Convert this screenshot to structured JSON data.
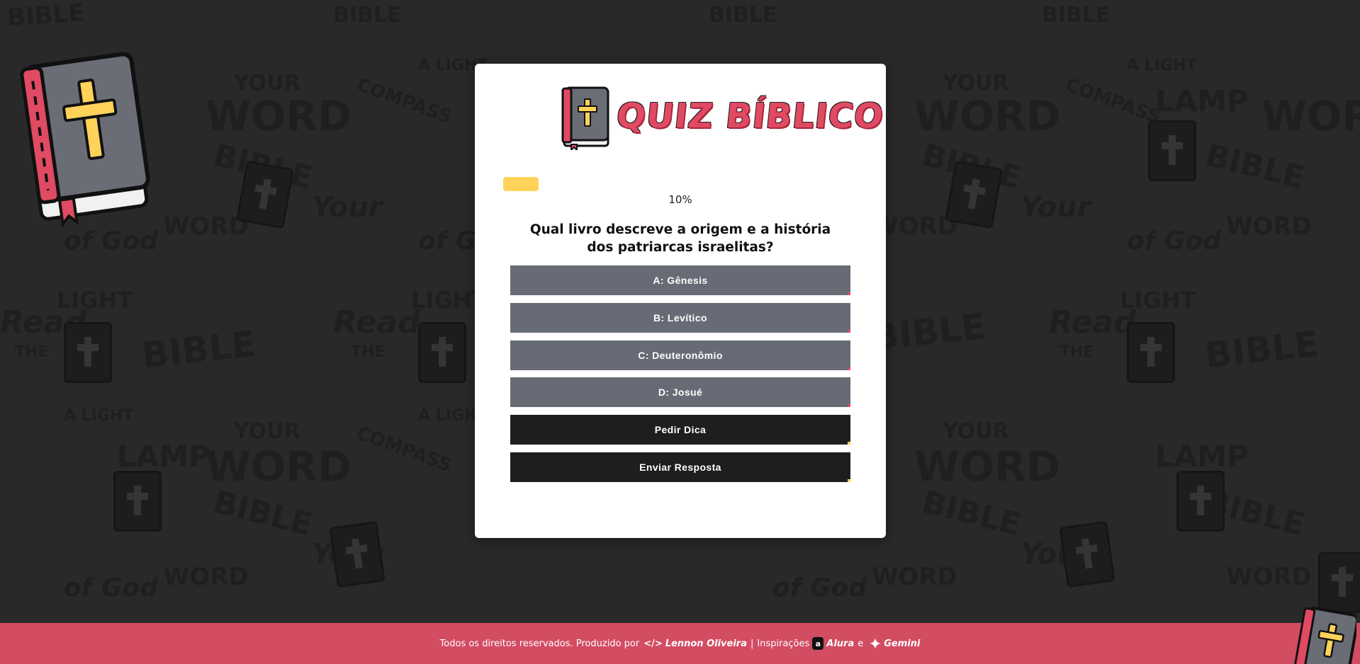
{
  "logo": {
    "text": "QUIZ BÍBLICO"
  },
  "progress": {
    "percent_label": "10%",
    "fraction": 0.1
  },
  "question": {
    "text": "Qual livro descreve a origem e a história dos patriarcas israelitas?"
  },
  "options": [
    {
      "label": "A: Gênesis"
    },
    {
      "label": "B: Levítico"
    },
    {
      "label": "C: Deuteronômio"
    },
    {
      "label": "D: Josué"
    }
  ],
  "actions": {
    "hint_label": "Pedir Dica",
    "submit_label": "Enviar Resposta"
  },
  "footer": {
    "prefix": "Todos os direitos reservados. Produzido por",
    "author": "Lennon Oliveira",
    "separator": "|",
    "inspirations_label": "Inspirações",
    "alura": "Alura",
    "conjunction": "e",
    "gemini": "Gemini"
  },
  "background_words": [
    "BIBLE",
    "WORD",
    "YOUR",
    "LAMP",
    "COMPASS",
    "A LIGHT",
    "Read",
    "THE",
    "of God",
    "LIGHT",
    "Your",
    "THE BIBLE"
  ],
  "colors": {
    "accent": "#e04a63",
    "progress": "#ffd25a",
    "option_bg": "#676b75",
    "action_bg": "#1e1e1e",
    "footer_bg": "#d24c62",
    "page_bg": "#2a2a2a"
  },
  "icons": {
    "logo_icon": "bible-book-icon",
    "corner_icon": "bible-book-icon",
    "author_icon": "code-icon",
    "alura_icon": "alura-logo-icon",
    "gemini_icon": "gemini-sparkle-icon"
  }
}
